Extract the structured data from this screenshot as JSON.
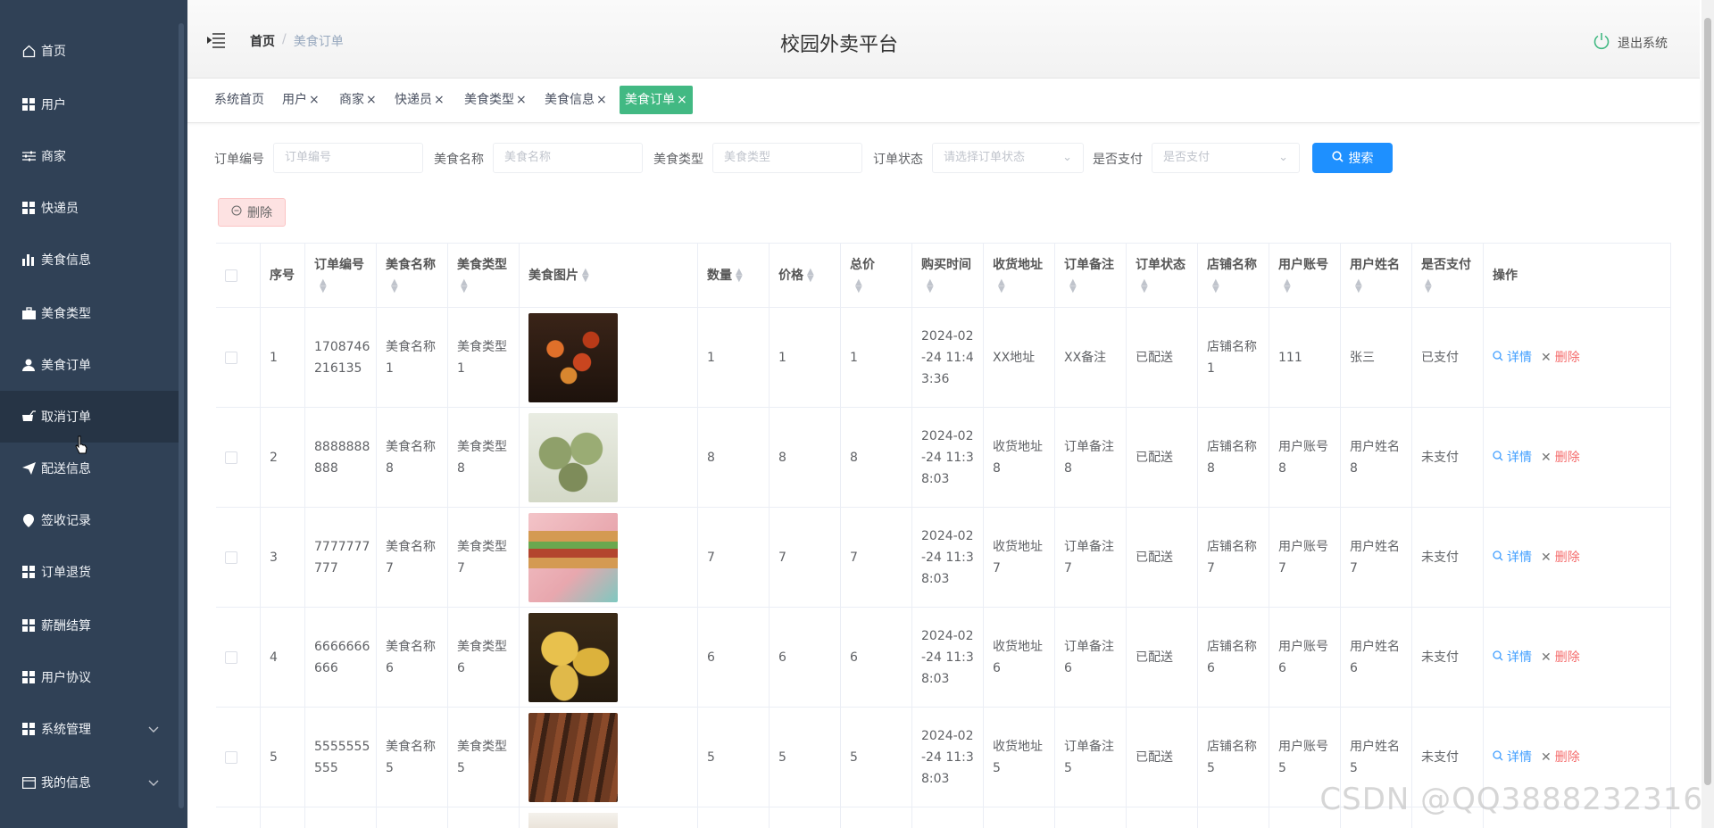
{
  "sidebar": {
    "items": [
      {
        "label": "首页",
        "icon": "home-icon"
      },
      {
        "label": "用户",
        "icon": "grid-icon"
      },
      {
        "label": "商家",
        "icon": "sliders-icon"
      },
      {
        "label": "快递员",
        "icon": "grid-icon"
      },
      {
        "label": "美食信息",
        "icon": "bar-chart-icon"
      },
      {
        "label": "美食类型",
        "icon": "briefcase-icon"
      },
      {
        "label": "美食订单",
        "icon": "user-icon"
      },
      {
        "label": "取消订单",
        "icon": "cart-icon"
      },
      {
        "label": "配送信息",
        "icon": "send-icon"
      },
      {
        "label": "签收记录",
        "icon": "location-icon"
      },
      {
        "label": "订单退货",
        "icon": "grid-icon"
      },
      {
        "label": "薪酬结算",
        "icon": "grid-icon"
      },
      {
        "label": "用户协议",
        "icon": "grid-icon"
      },
      {
        "label": "系统管理",
        "icon": "grid-icon"
      },
      {
        "label": "我的信息",
        "icon": "card-icon"
      }
    ]
  },
  "header": {
    "breadcrumb_home": "首页",
    "breadcrumb_current": "美食订单",
    "title": "校园外卖平台",
    "logout": "退出系统"
  },
  "tags": [
    "系统首页",
    "用户",
    "商家",
    "快递员",
    "美食类型",
    "美食信息",
    "美食订单"
  ],
  "search": {
    "order_no_label": "订单编号",
    "order_no_placeholder": "订单编号",
    "food_name_label": "美食名称",
    "food_name_placeholder": "美食名称",
    "food_type_label": "美食类型",
    "food_type_placeholder": "美食类型",
    "status_label": "订单状态",
    "status_placeholder": "请选择订单状态",
    "paid_label": "是否支付",
    "paid_placeholder": "是否支付",
    "search_button": "搜索",
    "delete_button": "删除"
  },
  "table": {
    "headers": [
      "序号",
      "订单编号",
      "美食名称",
      "美食类型",
      "美食图片",
      "数量",
      "价格",
      "总价",
      "购买时间",
      "收货地址",
      "订单备注",
      "订单状态",
      "店铺名称",
      "用户账号",
      "用户姓名",
      "是否支付",
      "操作"
    ],
    "action_detail": "详情",
    "action_delete": "删除",
    "rows": [
      {
        "no": "1",
        "order": "1708746\n216135",
        "name": "美食名称\n1",
        "type": "美食类型\n1",
        "qty": "1",
        "price": "1",
        "total": "1",
        "time": "2024-02\n-24 11:4\n3:36",
        "addr": "XX地址",
        "note": "XX备注",
        "status": "已配送",
        "shop": "店铺名称\n1",
        "account": "111",
        "uname": "张三",
        "paid": "已支付"
      },
      {
        "no": "2",
        "order": "8888888\n888",
        "name": "美食名称\n8",
        "type": "美食类型\n8",
        "qty": "8",
        "price": "8",
        "total": "8",
        "time": "2024-02\n-24 11:3\n8:03",
        "addr": "收货地址\n8",
        "note": "订单备注\n8",
        "status": "已配送",
        "shop": "店铺名称\n8",
        "account": "用户账号\n8",
        "uname": "用户姓名\n8",
        "paid": "未支付"
      },
      {
        "no": "3",
        "order": "7777777\n777",
        "name": "美食名称\n7",
        "type": "美食类型\n7",
        "qty": "7",
        "price": "7",
        "total": "7",
        "time": "2024-02\n-24 11:3\n8:03",
        "addr": "收货地址\n7",
        "note": "订单备注\n7",
        "status": "已配送",
        "shop": "店铺名称\n7",
        "account": "用户账号\n7",
        "uname": "用户姓名\n7",
        "paid": "未支付"
      },
      {
        "no": "4",
        "order": "6666666\n666",
        "name": "美食名称\n6",
        "type": "美食类型\n6",
        "qty": "6",
        "price": "6",
        "total": "6",
        "time": "2024-02\n-24 11:3\n8:03",
        "addr": "收货地址\n6",
        "note": "订单备注\n6",
        "status": "已配送",
        "shop": "店铺名称\n6",
        "account": "用户账号\n6",
        "uname": "用户姓名\n6",
        "paid": "未支付"
      },
      {
        "no": "5",
        "order": "5555555\n555",
        "name": "美食名称\n5",
        "type": "美食类型\n5",
        "qty": "5",
        "price": "5",
        "total": "5",
        "time": "2024-02\n-24 11:3\n8:03",
        "addr": "收货地址\n5",
        "note": "订单备注\n5",
        "status": "已配送",
        "shop": "店铺名称\n5",
        "account": "用户账号\n5",
        "uname": "用户姓名\n5",
        "paid": "未支付"
      }
    ]
  },
  "watermark": "CSDN @QQ3888232316",
  "colors": {
    "sidebar_bg": "#304156",
    "accent": "#42b983",
    "primary": "#1e90ff",
    "danger": "#f56c6c"
  }
}
